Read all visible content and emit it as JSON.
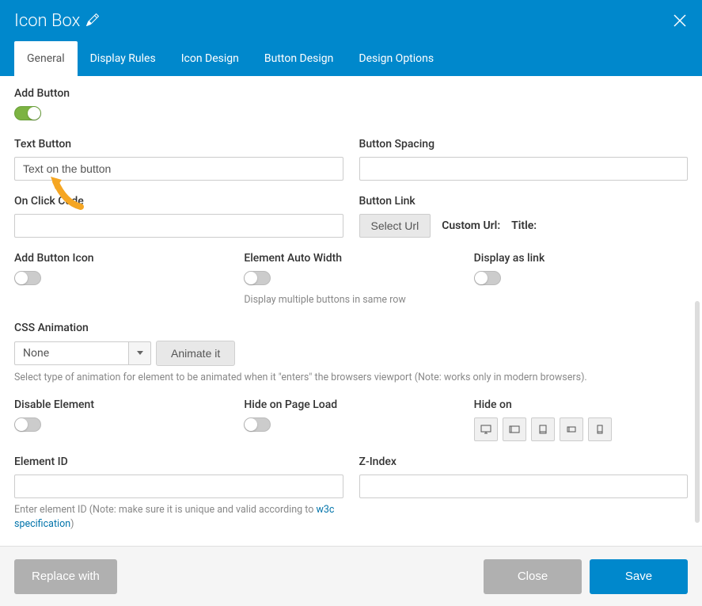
{
  "header": {
    "title": "Icon Box"
  },
  "tabs": [
    {
      "label": "General",
      "active": true
    },
    {
      "label": "Display Rules",
      "active": false
    },
    {
      "label": "Icon Design",
      "active": false
    },
    {
      "label": "Button Design",
      "active": false
    },
    {
      "label": "Design Options",
      "active": false
    }
  ],
  "fields": {
    "add_button": {
      "label": "Add Button",
      "on": true
    },
    "text_button": {
      "label": "Text Button",
      "value": "Text on the button"
    },
    "button_spacing": {
      "label": "Button Spacing",
      "value": ""
    },
    "on_click_code": {
      "label": "On Click Code",
      "value": ""
    },
    "button_link": {
      "label": "Button Link",
      "select_url": "Select Url",
      "custom_url": "Custom Url:",
      "title": "Title:"
    },
    "add_button_icon": {
      "label": "Add Button Icon",
      "on": false
    },
    "element_auto_width": {
      "label": "Element Auto Width",
      "on": false,
      "helper": "Display multiple buttons in same row"
    },
    "display_as_link": {
      "label": "Display as link",
      "on": false
    },
    "css_animation": {
      "label": "CSS Animation",
      "value": "None",
      "animate_btn": "Animate it",
      "helper": "Select type of animation for element to be animated when it \"enters\" the browsers viewport (Note: works only in modern browsers)."
    },
    "disable_element": {
      "label": "Disable Element",
      "on": false
    },
    "hide_on_page_load": {
      "label": "Hide on Page Load",
      "on": false
    },
    "hide_on": {
      "label": "Hide on"
    },
    "element_id": {
      "label": "Element ID",
      "value": "",
      "helper_pre": "Enter element ID (Note: make sure it is unique and valid according to ",
      "helper_link": "w3c specification",
      "helper_post": ")"
    },
    "z_index": {
      "label": "Z-Index",
      "value": ""
    }
  },
  "footer": {
    "replace": "Replace with",
    "close": "Close",
    "save": "Save"
  }
}
